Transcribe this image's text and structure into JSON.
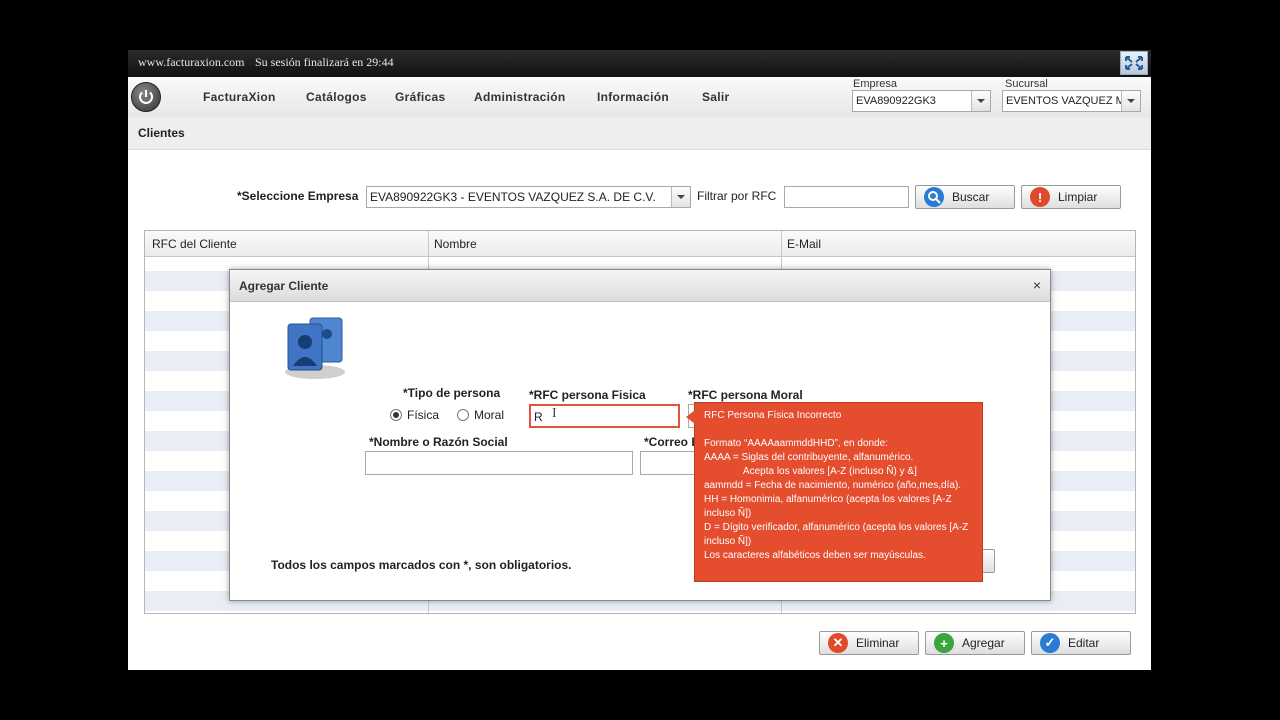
{
  "topbar": {
    "site": "www.facturaxion.com",
    "session": "Su sesión finalizará en 29:44"
  },
  "nav": {
    "items": [
      "FacturaXion",
      "Catálogos",
      "Gráficas",
      "Administración",
      "Información",
      "Salir"
    ]
  },
  "header": {
    "empresa_label": "Empresa",
    "empresa_value": "EVA890922GK3",
    "sucursal_label": "Sucursal",
    "sucursal_value": "EVENTOS VAZQUEZ M"
  },
  "section": {
    "title": "Clientes"
  },
  "filters": {
    "empresa_label": "*Seleccione Empresa",
    "empresa_value": "EVA890922GK3 - EVENTOS VAZQUEZ S.A. DE C.V.",
    "rfc_label": "Filtrar por RFC",
    "rfc_value": "",
    "buscar_label": "Buscar",
    "limpiar_label": "Limpiar"
  },
  "table": {
    "columns": [
      "RFC del Cliente",
      "Nombre",
      "E-Mail"
    ]
  },
  "modal": {
    "title": "Agregar Cliente",
    "close": "×",
    "tipo_label": "*Tipo de persona",
    "fisica_label": "Física",
    "moral_label": "Moral",
    "selected_tipo": "Física",
    "rfc_fisica_label": "*RFC persona Fisica",
    "rfc_fisica_value": "R",
    "rfc_moral_label": "*RFC persona Moral",
    "nombre_label": "*Nombre o Razón Social",
    "correo_label": "*Correo E",
    "required_note": "Todos los campos marcados con *, son obligatorios."
  },
  "tooltip": {
    "title": "RFC Persona Física Incorrecto",
    "lines": [
      "Formato “AAAAaammddHHD”, en donde:",
      "AAAA = Siglas del contribuyente, alfanumérico.",
      "              Acepta los valores [A-Z (incluso Ñ) y &]",
      "aammdd = Fecha de nacimiento, numérico (año,mes,día).",
      "HH = Homonimia, alfanumérico (acepta los valores [A-Z incluso Ñ])",
      "D = Dígito verificador, alfanumérico (acepta los valores [A-Z incluso Ñ])",
      "Los caracteres alfabéticos deben ser mayúsculas."
    ]
  },
  "actions": {
    "eliminar": "Eliminar",
    "agregar": "Agregar",
    "editar": "Editar"
  },
  "colors": {
    "tooltip_bg": "#e44d2e",
    "buscar_icon": "#2a7bd3",
    "limpiar_icon": "#e0492a",
    "agregar_icon": "#3aa53a"
  }
}
